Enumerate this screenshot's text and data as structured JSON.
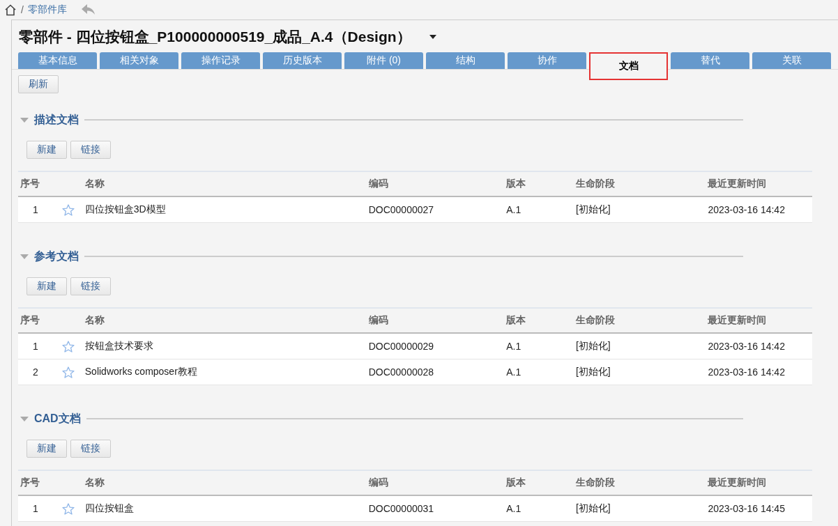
{
  "breadcrumb": {
    "separator": "/",
    "current": "零部件库"
  },
  "title": "零部件 - 四位按钮盒_P100000000519_成品_A.4（Design）",
  "tabs": [
    {
      "label": "基本信息",
      "selected": false
    },
    {
      "label": "相关对象",
      "selected": false
    },
    {
      "label": "操作记录",
      "selected": false
    },
    {
      "label": "历史版本",
      "selected": false
    },
    {
      "label": "附件 (0)",
      "selected": false
    },
    {
      "label": "结构",
      "selected": false
    },
    {
      "label": "协作",
      "selected": false
    },
    {
      "label": "文档",
      "selected": true
    },
    {
      "label": "替代",
      "selected": false
    },
    {
      "label": "关联",
      "selected": false
    }
  ],
  "refresh_button": "刷新",
  "sections": [
    {
      "title": "描述文档",
      "expanded": true,
      "buttons": [
        "新建",
        "链接"
      ],
      "columns": [
        "序号",
        "名称",
        "编码",
        "版本",
        "生命阶段",
        "最近更新时间"
      ],
      "rows": [
        {
          "index": "1",
          "name": "四位按钮盒3D模型",
          "code": "DOC00000027",
          "version": "A.1",
          "stage": "[初始化]",
          "updated": "2023-03-16 14:42"
        }
      ]
    },
    {
      "title": "参考文档",
      "expanded": true,
      "buttons": [
        "新建",
        "链接"
      ],
      "columns": [
        "序号",
        "名称",
        "编码",
        "版本",
        "生命阶段",
        "最近更新时间"
      ],
      "rows": [
        {
          "index": "1",
          "name": "按钮盒技术要求",
          "code": "DOC00000029",
          "version": "A.1",
          "stage": "[初始化]",
          "updated": "2023-03-16 14:42"
        },
        {
          "index": "2",
          "name": "Solidworks composer教程",
          "code": "DOC00000028",
          "version": "A.1",
          "stage": "[初始化]",
          "updated": "2023-03-16 14:42"
        }
      ]
    },
    {
      "title": "CAD文档",
      "expanded": true,
      "buttons": [
        "新建",
        "链接"
      ],
      "columns": [
        "序号",
        "名称",
        "编码",
        "版本",
        "生命阶段",
        "最近更新时间"
      ],
      "rows": [
        {
          "index": "1",
          "name": "四位按钮盒",
          "code": "DOC00000031",
          "version": "A.1",
          "stage": "[初始化]",
          "updated": "2023-03-16 14:45"
        }
      ]
    }
  ]
}
